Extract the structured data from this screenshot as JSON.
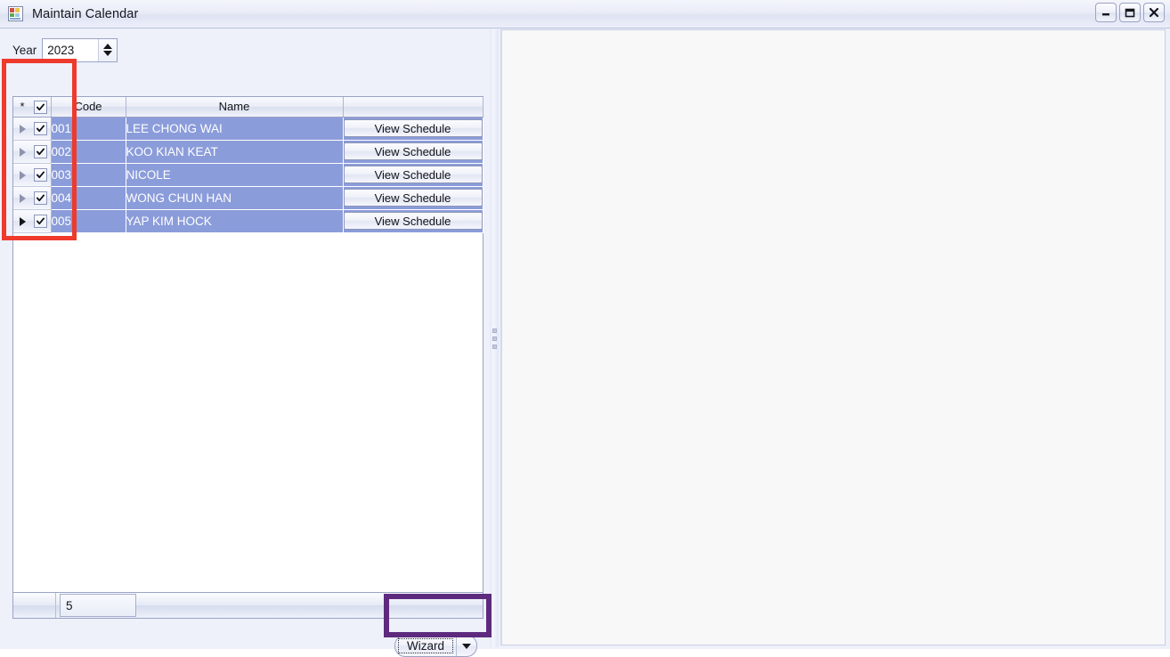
{
  "window": {
    "title": "Maintain Calendar",
    "icon": "calendar-icon",
    "controls": {
      "minimize_label": "Minimize",
      "maximize_label": "Maximize",
      "close_label": "Close"
    }
  },
  "left_panel": {
    "year_filter": {
      "label": "Year",
      "value": "2023",
      "spin_up_label": "Increase year",
      "spin_down_label": "Decrease year"
    },
    "grid": {
      "headers": {
        "indicator": "",
        "select_all": "",
        "new_row_marker": "*",
        "code": "Code",
        "name": "Name",
        "action": ""
      },
      "rows": [
        {
          "code": "001",
          "name": "LEE CHONG WAI",
          "checked": true,
          "action_label": "View Schedule",
          "current": false
        },
        {
          "code": "002",
          "name": "KOO KIAN KEAT",
          "checked": true,
          "action_label": "View Schedule",
          "current": false
        },
        {
          "code": "003",
          "name": "NICOLE",
          "checked": true,
          "action_label": "View Schedule",
          "current": false
        },
        {
          "code": "004",
          "name": "WONG CHUN HAN",
          "checked": true,
          "action_label": "View Schedule",
          "current": false
        },
        {
          "code": "005",
          "name": "YAP KIM HOCK",
          "checked": true,
          "action_label": "View Schedule",
          "current": true
        }
      ],
      "footer": {
        "record_count": "5"
      }
    },
    "wizard": {
      "label": "Wizard",
      "dropdown_label": "Open wizard options"
    }
  },
  "right_panel": {
    "content": ""
  },
  "annotations": {
    "red_box_target": "grid-row-selector-column",
    "purple_box_target": "wizard-button-group"
  },
  "colors": {
    "selected_row": "#8b9cda",
    "annotation_red": "#ee3a2c",
    "annotation_purple": "#5d2a7e",
    "window_chrome": "#eef0fa"
  }
}
